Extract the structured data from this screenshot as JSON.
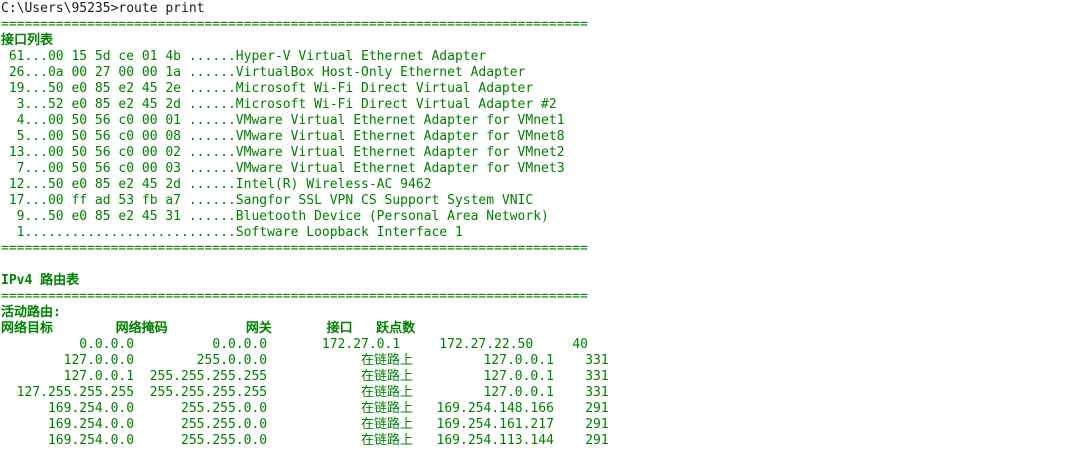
{
  "colors": {
    "background": "#ffffff",
    "text": "#008000",
    "prompt": "#1a1a1a"
  },
  "console": {
    "prompt": "C:\\Users\\95235>route print",
    "separator": "===========================================================================",
    "interface_header": "接口列表",
    "interfaces": [
      " 61...00 15 5d ce 01 4b ......Hyper-V Virtual Ethernet Adapter",
      " 26...0a 00 27 00 00 1a ......VirtualBox Host-Only Ethernet Adapter",
      " 19...50 e0 85 e2 45 2e ......Microsoft Wi-Fi Direct Virtual Adapter",
      "  3...52 e0 85 e2 45 2d ......Microsoft Wi-Fi Direct Virtual Adapter #2",
      "  4...00 50 56 c0 00 01 ......VMware Virtual Ethernet Adapter for VMnet1",
      "  5...00 50 56 c0 00 08 ......VMware Virtual Ethernet Adapter for VMnet8",
      " 13...00 50 56 c0 00 02 ......VMware Virtual Ethernet Adapter for VMnet2",
      "  7...00 50 56 c0 00 03 ......VMware Virtual Ethernet Adapter for VMnet3",
      " 12...50 e0 85 e2 45 2d ......Intel(R) Wireless-AC 9462",
      " 17...00 ff ad 53 fb a7 ......Sangfor SSL VPN CS Support System VNIC",
      "  9...50 e0 85 e2 45 31 ......Bluetooth Device (Personal Area Network)",
      "  1...........................Software Loopback Interface 1"
    ],
    "ipv4_header": "IPv4 路由表",
    "active_routes_header": "活动路由:",
    "route_columns": "网络目标        网络掩码          网关       接口   跃点数",
    "routes": [
      "          0.0.0.0          0.0.0.0       172.27.0.1     172.27.22.50     40",
      "        127.0.0.0        255.0.0.0            在链路上         127.0.0.1    331",
      "        127.0.0.1  255.255.255.255            在链路上         127.0.0.1    331",
      "  127.255.255.255  255.255.255.255            在链路上         127.0.0.1    331",
      "      169.254.0.0      255.255.0.0            在链路上   169.254.148.166    291",
      "      169.254.0.0      255.255.0.0            在链路上   169.254.161.217    291",
      "      169.254.0.0      255.255.0.0            在链路上   169.254.113.144    291"
    ]
  }
}
